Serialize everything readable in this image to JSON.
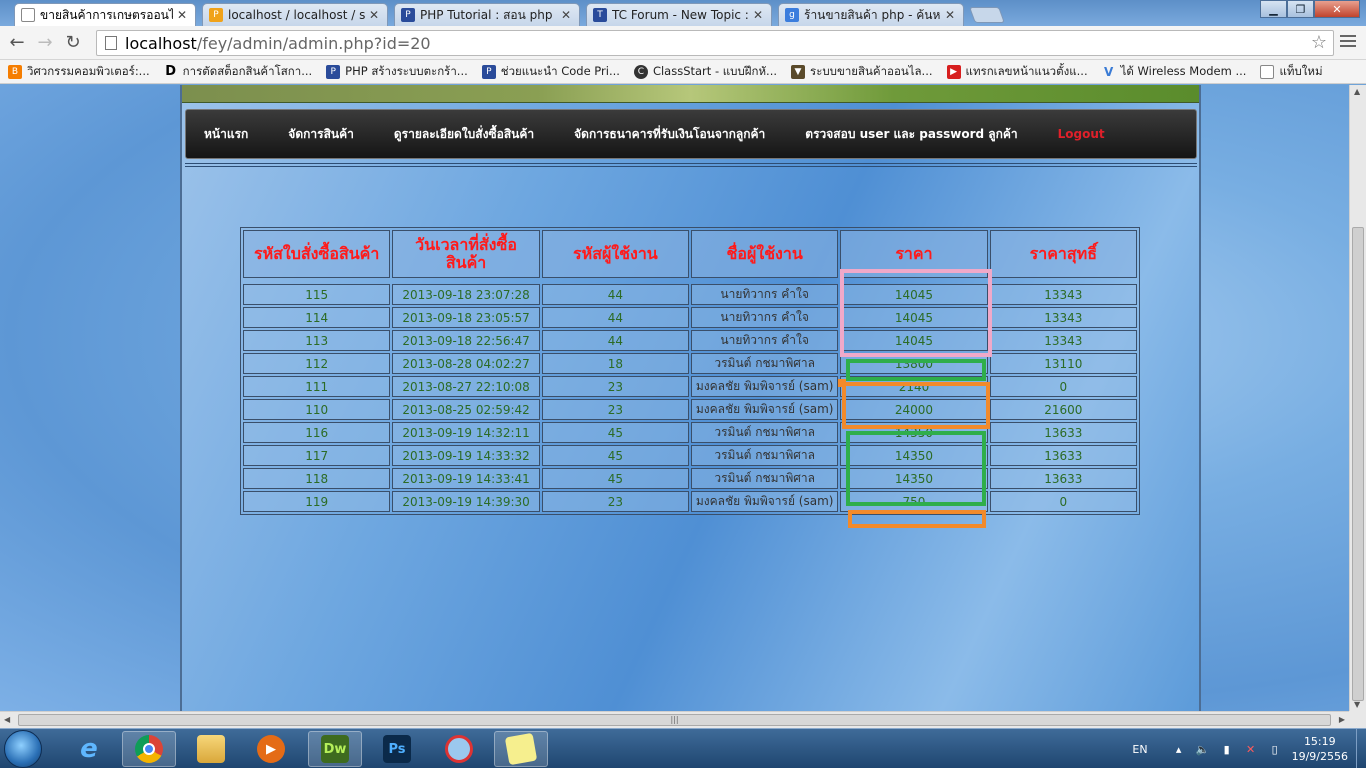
{
  "browser": {
    "tabs": [
      {
        "title": "ขายสินค้าการเกษตรออนไลน์",
        "icon": "page-icon",
        "active": true
      },
      {
        "title": "localhost / localhost / sell",
        "icon": "phpmyadmin-icon",
        "active": false
      },
      {
        "title": "PHP Tutorial : สอน php เริ่",
        "icon": "php-tutorial-icon",
        "active": false
      },
      {
        "title": "TC Forum - New Topic :: ",
        "icon": "forum-icon",
        "active": false
      },
      {
        "title": "ร้านขายสินค้า php - ค้นหาด้",
        "icon": "google-icon",
        "active": false
      }
    ],
    "url_host": "localhost",
    "url_path": "/fey/admin/admin.php?id=20",
    "bookmarks": [
      {
        "label": "วิศวกรรมคอมพิวเตอร์:...",
        "icon": "blogger-icon",
        "color": "#f57d00"
      },
      {
        "label": "การตัดสต็อกสินค้าโสกา...",
        "icon": "d-icon",
        "color": "#000000"
      },
      {
        "label": "PHP สร้างระบบตะกร้า...",
        "icon": "php-icon",
        "color": "#2a4b9a"
      },
      {
        "label": "ช่วยแนะนำ Code Pri...",
        "icon": "php-icon",
        "color": "#2a4b9a"
      },
      {
        "label": "ClassStart - แบบฝึกหั...",
        "icon": "classstart-icon",
        "color": "#333333"
      },
      {
        "label": "ระบบขายสินค้าออนไล...",
        "icon": "shield-icon",
        "color": "#5a4a2a"
      },
      {
        "label": "แทรกเลขหน้าแนวตั้งแ...",
        "icon": "youtube-icon",
        "color": "#d71e1e"
      },
      {
        "label": "ได้ Wireless Modem ...",
        "icon": "v-icon",
        "color": "#3a7bd5"
      },
      {
        "label": "แท็บใหม่",
        "icon": "page-icon",
        "color": "#ffffff"
      }
    ]
  },
  "nav": {
    "home": "หน้าแรก",
    "manage_products": "จัดการสินค้า",
    "order_details": "ดูรายละเอียดใบสั่งซื้อสินค้า",
    "manage_banks": "จัดการธนาคารที่รับเงินโอนจากลูกค้า",
    "check_users": "ตรวจสอบ user และ password ลูกค้า",
    "logout": "Logout"
  },
  "table": {
    "headers": [
      "รหัสใบสั่งซื้อสินค้า",
      "วันเวลาที่สั่งซื้อสินค้า",
      "รหัสผู้ใช้งาน",
      "ชื่อผู้ใช้งาน",
      "ราคา",
      "ราคาสุทธิ์"
    ],
    "rows": [
      [
        "115",
        "2013-09-18 23:07:28",
        "44",
        "นายทิวากร คำใจ",
        "14045",
        "13343"
      ],
      [
        "114",
        "2013-09-18 23:05:57",
        "44",
        "นายทิวากร คำใจ",
        "14045",
        "13343"
      ],
      [
        "113",
        "2013-09-18 22:56:47",
        "44",
        "นายทิวากร คำใจ",
        "14045",
        "13343"
      ],
      [
        "112",
        "2013-08-28 04:02:27",
        "18",
        "วรมินต์ กชมาพิศาล",
        "13800",
        "13110"
      ],
      [
        "111",
        "2013-08-27 22:10:08",
        "23",
        "มงคลชัย พิมพิจารย์ (sam)",
        "2140",
        "0"
      ],
      [
        "110",
        "2013-08-25 02:59:42",
        "23",
        "มงคลชัย พิมพิจารย์ (sam)",
        "24000",
        "21600"
      ],
      [
        "116",
        "2013-09-19 14:32:11",
        "45",
        "วรมินต์ กชมาพิศาล",
        "14350",
        "13633"
      ],
      [
        "117",
        "2013-09-19 14:33:32",
        "45",
        "วรมินต์ กชมาพิศาล",
        "14350",
        "13633"
      ],
      [
        "118",
        "2013-09-19 14:33:41",
        "45",
        "วรมินต์ กชมาพิศาล",
        "14350",
        "13633"
      ],
      [
        "119",
        "2013-09-19 14:39:30",
        "23",
        "มงคลชัย พิมพิจารย์ (sam)",
        "750",
        "0"
      ]
    ]
  },
  "highlights": {
    "pink": "#f0a9c9",
    "green": "#2fae4b",
    "orange": "#f28a2b"
  },
  "taskbar": {
    "apps": [
      {
        "name": "internet-explorer-icon",
        "label": "e"
      },
      {
        "name": "chrome-icon",
        "label": ""
      },
      {
        "name": "file-explorer-icon",
        "label": ""
      },
      {
        "name": "media-player-icon",
        "label": ""
      },
      {
        "name": "dreamweaver-icon",
        "label": "Dw"
      },
      {
        "name": "photoshop-icon",
        "label": "Ps"
      },
      {
        "name": "app-icon",
        "label": ""
      },
      {
        "name": "sticky-notes-icon",
        "label": ""
      }
    ],
    "lang": "EN",
    "time": "15:19",
    "date": "19/9/2556"
  }
}
